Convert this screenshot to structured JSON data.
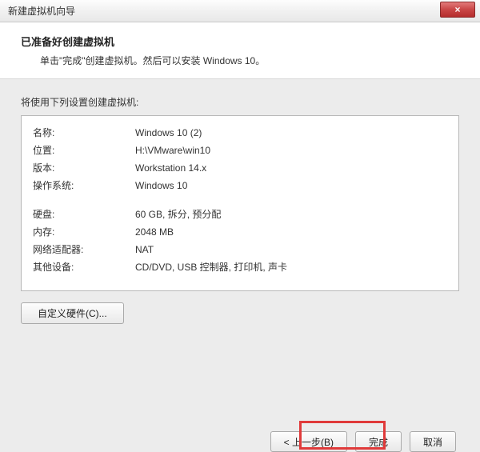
{
  "window": {
    "title": "新建虚拟机向导",
    "close_glyph": "×"
  },
  "header": {
    "title": "已准备好创建虚拟机",
    "subtitle": "单击\"完成\"创建虚拟机。然后可以安装 Windows 10。"
  },
  "intro": "将使用下列设置创建虚拟机:",
  "rows_a": [
    {
      "label": "名称:",
      "value": "Windows 10 (2)"
    },
    {
      "label": "位置:",
      "value": "H:\\VMware\\win10"
    },
    {
      "label": "版本:",
      "value": "Workstation 14.x"
    },
    {
      "label": "操作系统:",
      "value": "Windows 10"
    }
  ],
  "rows_b": [
    {
      "label": "硬盘:",
      "value": "60 GB, 拆分, 预分配"
    },
    {
      "label": "内存:",
      "value": "2048 MB"
    },
    {
      "label": "网络适配器:",
      "value": "NAT"
    },
    {
      "label": "其他设备:",
      "value": "CD/DVD, USB 控制器, 打印机, 声卡"
    }
  ],
  "buttons": {
    "customize": "自定义硬件(C)...",
    "back": "< 上一步(B)",
    "finish": "完成",
    "cancel": "取消"
  }
}
